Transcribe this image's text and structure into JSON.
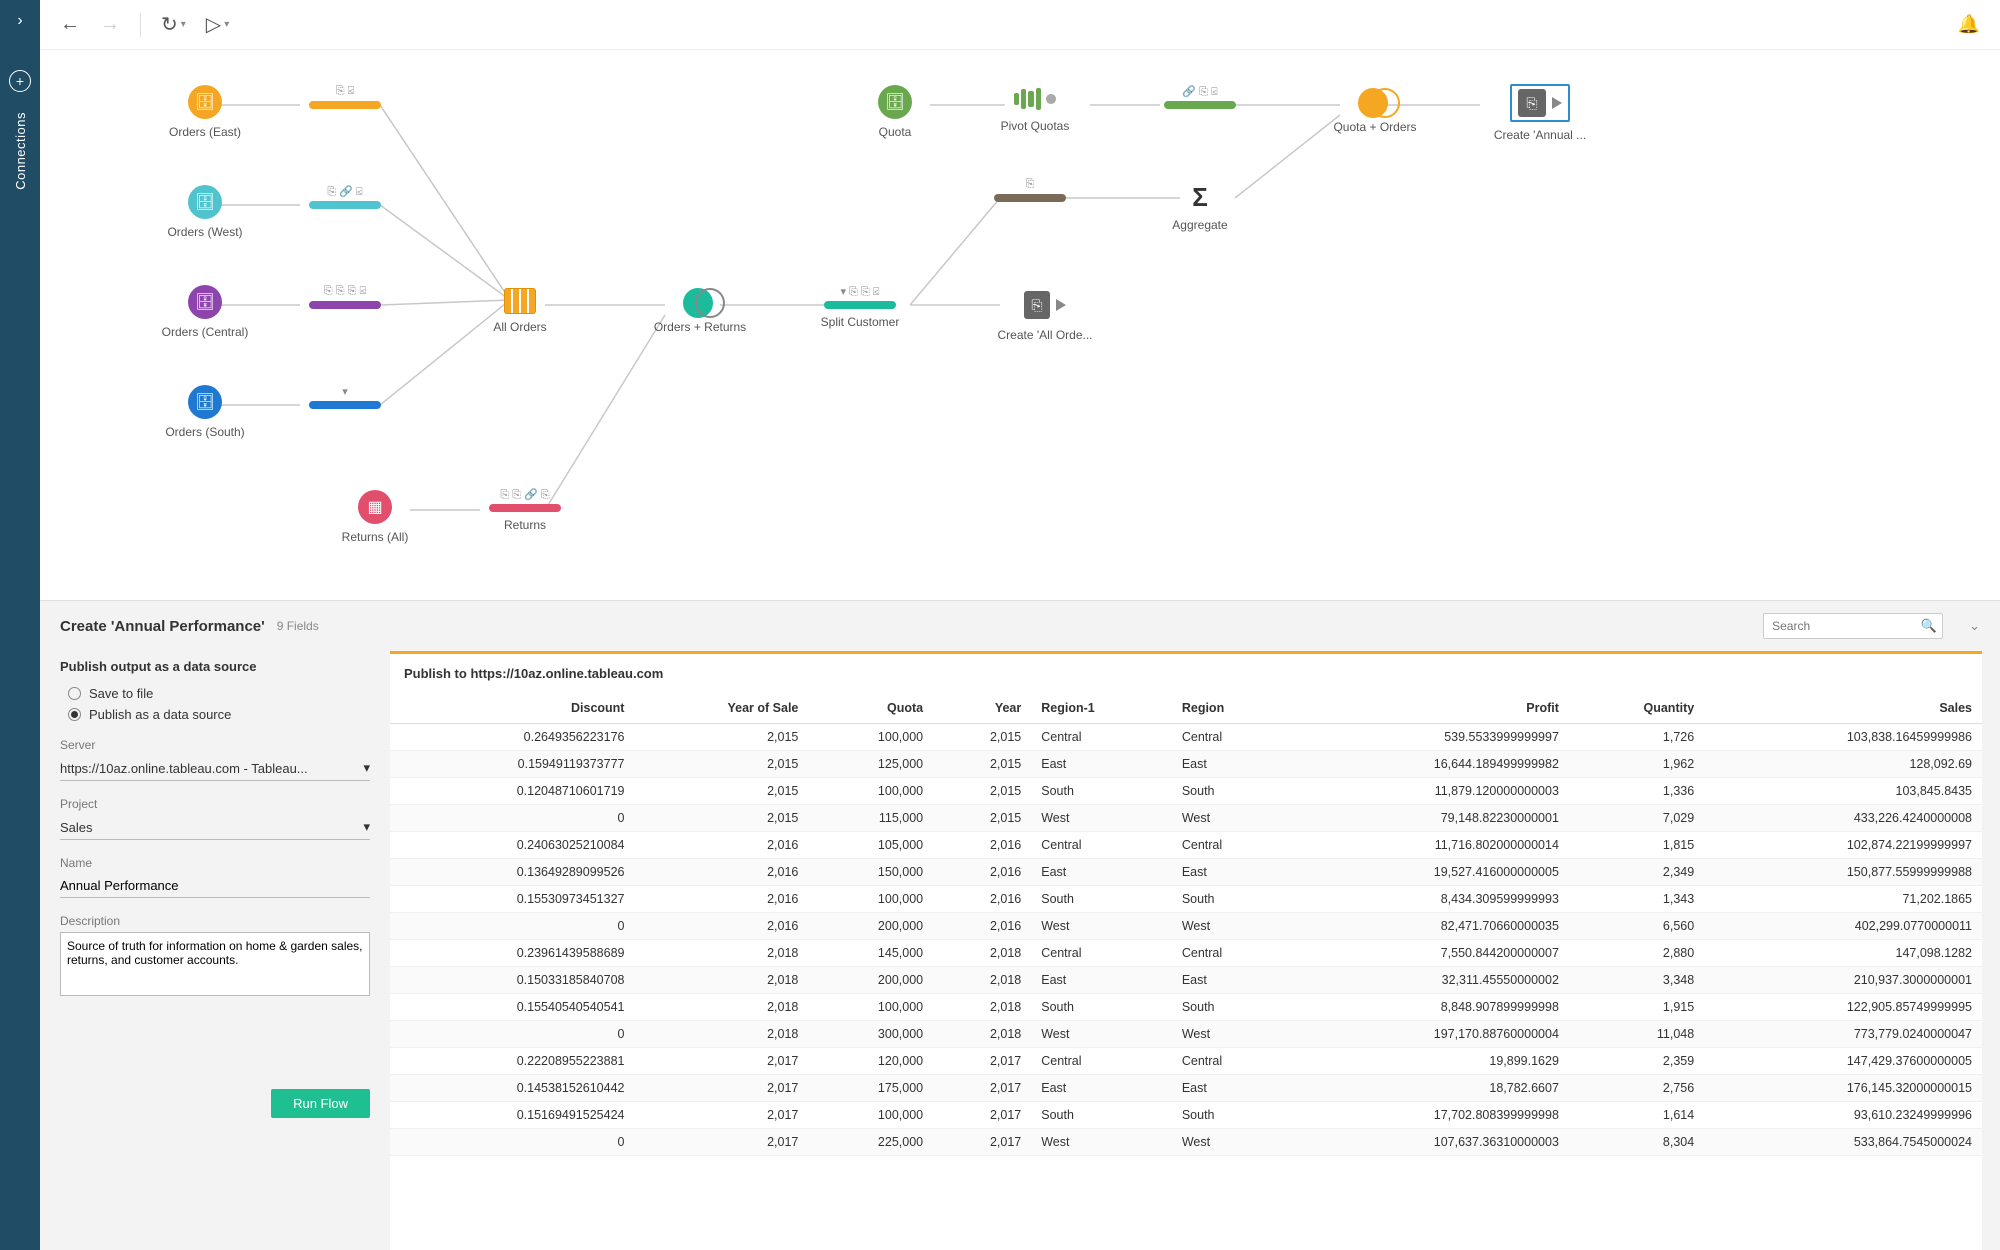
{
  "sidebar": {
    "label": "Connections"
  },
  "toolbar": {
    "back": "←",
    "forward": "→"
  },
  "nodes": {
    "orders_east": {
      "label": "Orders (East)",
      "color": "#f5a623"
    },
    "orders_west": {
      "label": "Orders (West)",
      "color": "#4fc4cf"
    },
    "orders_central": {
      "label": "Orders (Central)",
      "color": "#8e44ad"
    },
    "orders_south": {
      "label": "Orders (South)",
      "color": "#1f78d1"
    },
    "returns_all": {
      "label": "Returns (All)",
      "color": "#e14f6d"
    },
    "quota": {
      "label": "Quota",
      "color": "#6aa84f"
    },
    "step_east": {
      "label": "",
      "color": "#f5a623",
      "hints": "⎘ ⍃"
    },
    "step_west": {
      "label": "",
      "color": "#4fc4cf",
      "hints": "⎘ 🔗 ⍃"
    },
    "step_central": {
      "label": "",
      "color": "#8e44ad",
      "hints": "⎘ ⎘ ⎘ ⍃"
    },
    "step_south": {
      "label": "",
      "color": "#1f78d1",
      "hints": "▾"
    },
    "step_returns": {
      "label": "Returns",
      "color": "#e14f6d",
      "hints": "⎘ ⎘ 🔗 ⎘"
    },
    "step_quota": {
      "label": "",
      "color": "#6aa84f",
      "hints": ""
    },
    "step_above_agg": {
      "label": "",
      "color": "#7a6a58",
      "hints": "⎘"
    },
    "all_orders": {
      "label": "All Orders"
    },
    "orders_returns": {
      "label": "Orders + Returns"
    },
    "split_customer": {
      "label": "Split Customer",
      "color": "#1abc9c",
      "hints": "▾ ⎘ ⎘ ⍃"
    },
    "create_all_orders": {
      "label": "Create 'All Orde..."
    },
    "pivot_quotas": {
      "label": "Pivot Quotas"
    },
    "quota_orders": {
      "label": "Quota + Orders"
    },
    "step_quota_orders": {
      "label": "",
      "color": "#6aa84f",
      "hints": "🔗 ⎘ ⍃"
    },
    "aggregate": {
      "label": "Aggregate"
    },
    "create_annual": {
      "label": "Create 'Annual ..."
    }
  },
  "panel": {
    "title": "Create 'Annual Performance'",
    "fieldcount": "9 Fields",
    "search_ph": "Search",
    "form": {
      "heading": "Publish output as a data source",
      "save_to_file": "Save to file",
      "publish_ds": "Publish as a data source",
      "server_label": "Server",
      "server_value": "https://10az.online.tableau.com - Tableau...",
      "project_label": "Project",
      "project_value": "Sales",
      "name_label": "Name",
      "name_value": "Annual Performance",
      "desc_label": "Description",
      "desc_value": "Source of truth for information on home & garden sales, returns, and customer accounts.",
      "run": "Run Flow"
    },
    "publish_to": "Publish to https://10az.online.tableau.com",
    "columns": [
      "Discount",
      "Year of Sale",
      "Quota",
      "Year",
      "Region-1",
      "Region",
      "Profit",
      "Quantity",
      "Sales"
    ],
    "coltypes": [
      "num",
      "num",
      "num",
      "num",
      "txt",
      "txt",
      "num",
      "num",
      "num"
    ],
    "rows": [
      [
        "0.2649356223176",
        "2,015",
        "100,000",
        "2,015",
        "Central",
        "Central",
        "539.5533999999997",
        "1,726",
        "103,838.16459999986"
      ],
      [
        "0.15949119373777",
        "2,015",
        "125,000",
        "2,015",
        "East",
        "East",
        "16,644.189499999982",
        "1,962",
        "128,092.69"
      ],
      [
        "0.12048710601719",
        "2,015",
        "100,000",
        "2,015",
        "South",
        "South",
        "11,879.120000000003",
        "1,336",
        "103,845.8435"
      ],
      [
        "0",
        "2,015",
        "115,000",
        "2,015",
        "West",
        "West",
        "79,148.82230000001",
        "7,029",
        "433,226.4240000008"
      ],
      [
        "0.24063025210084",
        "2,016",
        "105,000",
        "2,016",
        "Central",
        "Central",
        "11,716.802000000014",
        "1,815",
        "102,874.22199999997"
      ],
      [
        "0.13649289099526",
        "2,016",
        "150,000",
        "2,016",
        "East",
        "East",
        "19,527.416000000005",
        "2,349",
        "150,877.55999999988"
      ],
      [
        "0.15530973451327",
        "2,016",
        "100,000",
        "2,016",
        "South",
        "South",
        "8,434.309599999993",
        "1,343",
        "71,202.1865"
      ],
      [
        "0",
        "2,016",
        "200,000",
        "2,016",
        "West",
        "West",
        "82,471.70660000035",
        "6,560",
        "402,299.0770000011"
      ],
      [
        "0.23961439588689",
        "2,018",
        "145,000",
        "2,018",
        "Central",
        "Central",
        "7,550.844200000007",
        "2,880",
        "147,098.1282"
      ],
      [
        "0.15033185840708",
        "2,018",
        "200,000",
        "2,018",
        "East",
        "East",
        "32,311.45550000002",
        "3,348",
        "210,937.3000000001"
      ],
      [
        "0.15540540540541",
        "2,018",
        "100,000",
        "2,018",
        "South",
        "South",
        "8,848.907899999998",
        "1,915",
        "122,905.85749999995"
      ],
      [
        "0",
        "2,018",
        "300,000",
        "2,018",
        "West",
        "West",
        "197,170.88760000004",
        "11,048",
        "773,779.0240000047"
      ],
      [
        "0.22208955223881",
        "2,017",
        "120,000",
        "2,017",
        "Central",
        "Central",
        "19,899.1629",
        "2,359",
        "147,429.37600000005"
      ],
      [
        "0.14538152610442",
        "2,017",
        "175,000",
        "2,017",
        "East",
        "East",
        "18,782.6607",
        "2,756",
        "176,145.32000000015"
      ],
      [
        "0.15169491525424",
        "2,017",
        "100,000",
        "2,017",
        "South",
        "South",
        "17,702.808399999998",
        "1,614",
        "93,610.23249999996"
      ],
      [
        "0",
        "2,017",
        "225,000",
        "2,017",
        "West",
        "West",
        "107,637.36310000003",
        "8,304",
        "533,864.7545000024"
      ]
    ]
  }
}
